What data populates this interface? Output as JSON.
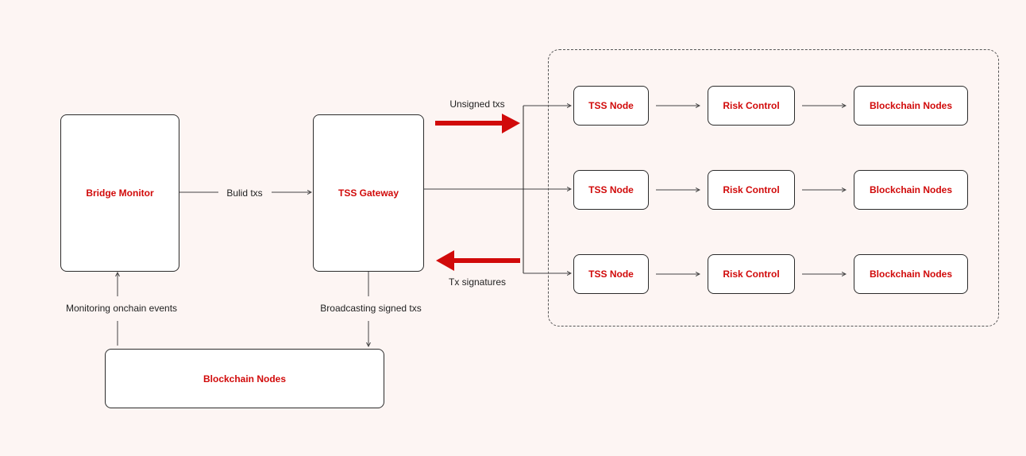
{
  "colors": {
    "background": "#fdf5f3",
    "accent": "#d10a0a",
    "line": "#2b2b2b"
  },
  "nodes": {
    "bridge_monitor": "Bridge Monitor",
    "tss_gateway": "TSS Gateway",
    "blockchain_nodes_bottom": "Blockchain Nodes"
  },
  "edges": {
    "build_txs": "Bulid txs",
    "unsigned_txs": "Unsigned txs",
    "tx_signatures": "Tx signatures",
    "monitoring": "Monitoring onchain events",
    "broadcasting": "Broadcasting signed txs"
  },
  "clusters": [
    {
      "tss_node": "TSS Node",
      "risk_control": "Risk Control",
      "blockchain_nodes": "Blockchain Nodes"
    },
    {
      "tss_node": "TSS Node",
      "risk_control": "Risk Control",
      "blockchain_nodes": "Blockchain Nodes"
    },
    {
      "tss_node": "TSS Node",
      "risk_control": "Risk Control",
      "blockchain_nodes": "Blockchain Nodes"
    }
  ]
}
